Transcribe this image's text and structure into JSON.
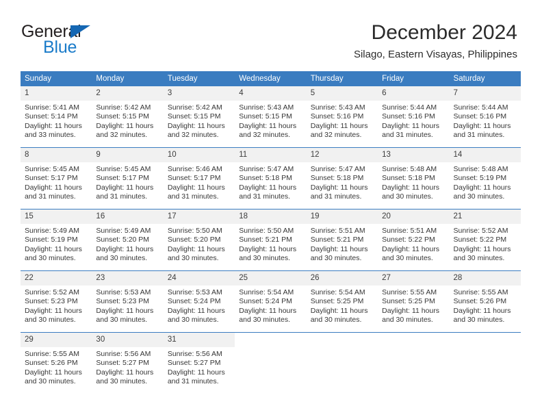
{
  "brand": {
    "name_top": "General",
    "name_bottom": "Blue",
    "triangle_color": "#1567b3",
    "blue_color": "#1a7bc9"
  },
  "header": {
    "title": "December 2024",
    "subtitle": "Silago, Eastern Visayas, Philippines"
  },
  "theme": {
    "header_bg": "#3a7cc0",
    "daynum_bg": "#f1f1f1",
    "grid_line": "#3a7cc0",
    "text": "#363636"
  },
  "calendar": {
    "weekday_headers": [
      "Sunday",
      "Monday",
      "Tuesday",
      "Wednesday",
      "Thursday",
      "Friday",
      "Saturday"
    ],
    "weeks": [
      [
        {
          "day": "1",
          "lines": [
            "Sunrise: 5:41 AM",
            "Sunset: 5:14 PM",
            "Daylight: 11 hours",
            "and 33 minutes."
          ]
        },
        {
          "day": "2",
          "lines": [
            "Sunrise: 5:42 AM",
            "Sunset: 5:15 PM",
            "Daylight: 11 hours",
            "and 32 minutes."
          ]
        },
        {
          "day": "3",
          "lines": [
            "Sunrise: 5:42 AM",
            "Sunset: 5:15 PM",
            "Daylight: 11 hours",
            "and 32 minutes."
          ]
        },
        {
          "day": "4",
          "lines": [
            "Sunrise: 5:43 AM",
            "Sunset: 5:15 PM",
            "Daylight: 11 hours",
            "and 32 minutes."
          ]
        },
        {
          "day": "5",
          "lines": [
            "Sunrise: 5:43 AM",
            "Sunset: 5:16 PM",
            "Daylight: 11 hours",
            "and 32 minutes."
          ]
        },
        {
          "day": "6",
          "lines": [
            "Sunrise: 5:44 AM",
            "Sunset: 5:16 PM",
            "Daylight: 11 hours",
            "and 31 minutes."
          ]
        },
        {
          "day": "7",
          "lines": [
            "Sunrise: 5:44 AM",
            "Sunset: 5:16 PM",
            "Daylight: 11 hours",
            "and 31 minutes."
          ]
        }
      ],
      [
        {
          "day": "8",
          "lines": [
            "Sunrise: 5:45 AM",
            "Sunset: 5:17 PM",
            "Daylight: 11 hours",
            "and 31 minutes."
          ]
        },
        {
          "day": "9",
          "lines": [
            "Sunrise: 5:45 AM",
            "Sunset: 5:17 PM",
            "Daylight: 11 hours",
            "and 31 minutes."
          ]
        },
        {
          "day": "10",
          "lines": [
            "Sunrise: 5:46 AM",
            "Sunset: 5:17 PM",
            "Daylight: 11 hours",
            "and 31 minutes."
          ]
        },
        {
          "day": "11",
          "lines": [
            "Sunrise: 5:47 AM",
            "Sunset: 5:18 PM",
            "Daylight: 11 hours",
            "and 31 minutes."
          ]
        },
        {
          "day": "12",
          "lines": [
            "Sunrise: 5:47 AM",
            "Sunset: 5:18 PM",
            "Daylight: 11 hours",
            "and 31 minutes."
          ]
        },
        {
          "day": "13",
          "lines": [
            "Sunrise: 5:48 AM",
            "Sunset: 5:18 PM",
            "Daylight: 11 hours",
            "and 30 minutes."
          ]
        },
        {
          "day": "14",
          "lines": [
            "Sunrise: 5:48 AM",
            "Sunset: 5:19 PM",
            "Daylight: 11 hours",
            "and 30 minutes."
          ]
        }
      ],
      [
        {
          "day": "15",
          "lines": [
            "Sunrise: 5:49 AM",
            "Sunset: 5:19 PM",
            "Daylight: 11 hours",
            "and 30 minutes."
          ]
        },
        {
          "day": "16",
          "lines": [
            "Sunrise: 5:49 AM",
            "Sunset: 5:20 PM",
            "Daylight: 11 hours",
            "and 30 minutes."
          ]
        },
        {
          "day": "17",
          "lines": [
            "Sunrise: 5:50 AM",
            "Sunset: 5:20 PM",
            "Daylight: 11 hours",
            "and 30 minutes."
          ]
        },
        {
          "day": "18",
          "lines": [
            "Sunrise: 5:50 AM",
            "Sunset: 5:21 PM",
            "Daylight: 11 hours",
            "and 30 minutes."
          ]
        },
        {
          "day": "19",
          "lines": [
            "Sunrise: 5:51 AM",
            "Sunset: 5:21 PM",
            "Daylight: 11 hours",
            "and 30 minutes."
          ]
        },
        {
          "day": "20",
          "lines": [
            "Sunrise: 5:51 AM",
            "Sunset: 5:22 PM",
            "Daylight: 11 hours",
            "and 30 minutes."
          ]
        },
        {
          "day": "21",
          "lines": [
            "Sunrise: 5:52 AM",
            "Sunset: 5:22 PM",
            "Daylight: 11 hours",
            "and 30 minutes."
          ]
        }
      ],
      [
        {
          "day": "22",
          "lines": [
            "Sunrise: 5:52 AM",
            "Sunset: 5:23 PM",
            "Daylight: 11 hours",
            "and 30 minutes."
          ]
        },
        {
          "day": "23",
          "lines": [
            "Sunrise: 5:53 AM",
            "Sunset: 5:23 PM",
            "Daylight: 11 hours",
            "and 30 minutes."
          ]
        },
        {
          "day": "24",
          "lines": [
            "Sunrise: 5:53 AM",
            "Sunset: 5:24 PM",
            "Daylight: 11 hours",
            "and 30 minutes."
          ]
        },
        {
          "day": "25",
          "lines": [
            "Sunrise: 5:54 AM",
            "Sunset: 5:24 PM",
            "Daylight: 11 hours",
            "and 30 minutes."
          ]
        },
        {
          "day": "26",
          "lines": [
            "Sunrise: 5:54 AM",
            "Sunset: 5:25 PM",
            "Daylight: 11 hours",
            "and 30 minutes."
          ]
        },
        {
          "day": "27",
          "lines": [
            "Sunrise: 5:55 AM",
            "Sunset: 5:25 PM",
            "Daylight: 11 hours",
            "and 30 minutes."
          ]
        },
        {
          "day": "28",
          "lines": [
            "Sunrise: 5:55 AM",
            "Sunset: 5:26 PM",
            "Daylight: 11 hours",
            "and 30 minutes."
          ]
        }
      ],
      [
        {
          "day": "29",
          "lines": [
            "Sunrise: 5:55 AM",
            "Sunset: 5:26 PM",
            "Daylight: 11 hours",
            "and 30 minutes."
          ]
        },
        {
          "day": "30",
          "lines": [
            "Sunrise: 5:56 AM",
            "Sunset: 5:27 PM",
            "Daylight: 11 hours",
            "and 30 minutes."
          ]
        },
        {
          "day": "31",
          "lines": [
            "Sunrise: 5:56 AM",
            "Sunset: 5:27 PM",
            "Daylight: 11 hours",
            "and 31 minutes."
          ]
        },
        null,
        null,
        null,
        null
      ]
    ]
  }
}
